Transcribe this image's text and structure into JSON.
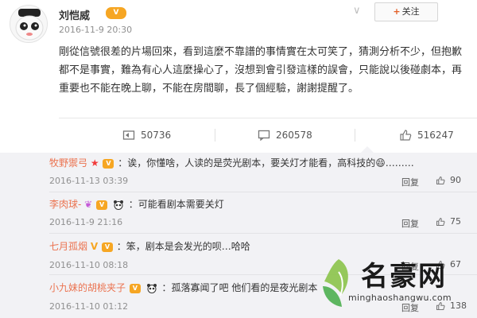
{
  "post": {
    "username": "刘恺威",
    "vip_badge": "V",
    "time": "2016-11-9 20:30",
    "follow_label": "关注",
    "body": "剛從信號很差的片場回來，看到這麼不靠譜的事情實在太可笑了，猜測分析不少，但抱歉都不是事實，難為有心人這麼操心了，沒想到會引發這樣的誤會，只能說以後碰劇本，再重要也不能在晚上聊，不能在房間聊，長了個經驗，謝謝提醒了。",
    "actions": {
      "repost_count": "50736",
      "comment_count": "260578",
      "like_count": "516247"
    }
  },
  "comments": [
    {
      "name": "牧野禦弓",
      "text": "：诶，你懂啥，人读的是荧光剧本，要关灯才能看，高科技的😄………",
      "time": "2016-11-13 03:39",
      "reply_label": "回复",
      "likes": "90"
    },
    {
      "name": "李肉球-",
      "text": "：可能看剧本需要关灯",
      "time": "2016-11-9 21:16",
      "reply_label": "回复",
      "likes": "75"
    },
    {
      "name": "七月孤烟",
      "text": "：笨，剧本是会发光的呗…哈哈",
      "time": "2016-11-10 08:18",
      "reply_label": "回复",
      "likes": "67"
    },
    {
      "name": "小九妹的胡桃夹子",
      "text": "：孤落寡闻了吧 他们看的是夜光剧本",
      "time": "2016-11-10 01:12",
      "reply_label": "回复",
      "likes": "138"
    }
  ],
  "watermark": {
    "title": "名豪网",
    "url": "minghaoshangwu.com"
  },
  "colors": {
    "accent": "#eb7350",
    "badge": "#f6a623",
    "comment_bg": "#f2f2f5"
  },
  "icons": [
    "avatar",
    "vip-badge-icon",
    "chevron-down-icon",
    "plus-icon",
    "repost-icon",
    "comment-icon",
    "like-icon",
    "star-icon",
    "panda-emoji-icon",
    "butterfly-icon"
  ]
}
